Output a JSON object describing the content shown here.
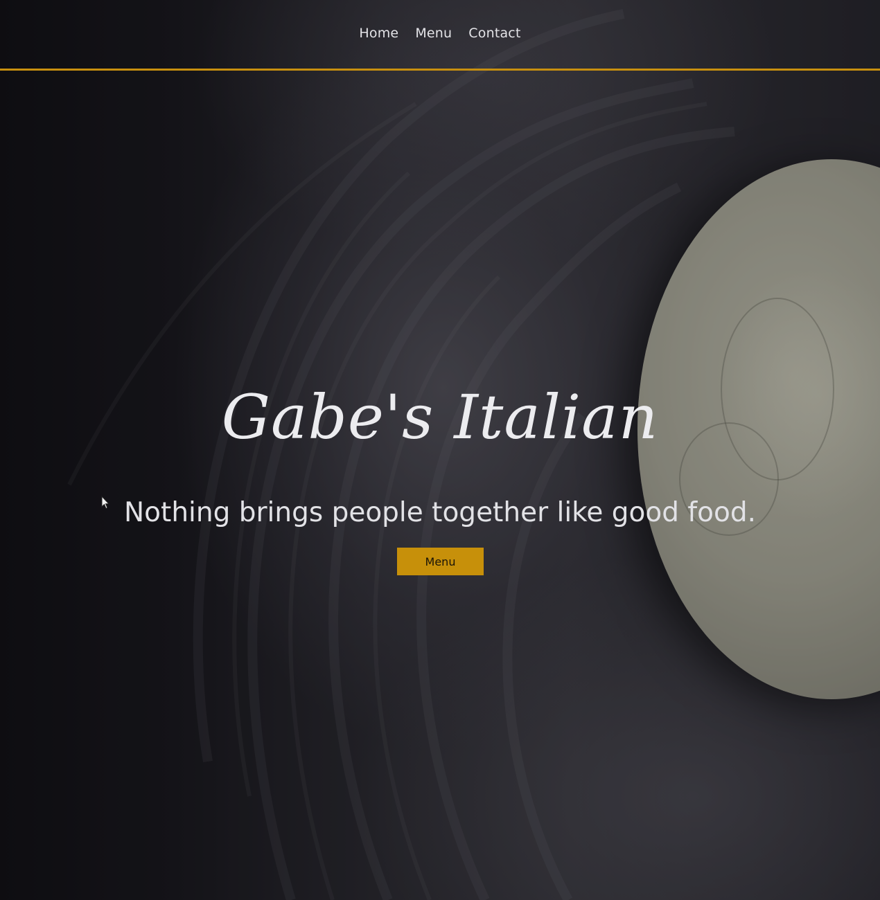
{
  "nav": {
    "items": [
      {
        "label": "Home"
      },
      {
        "label": "Menu"
      },
      {
        "label": "Contact"
      }
    ],
    "accent_color": "#c8900f"
  },
  "hero": {
    "title": "Gabe's Italian",
    "tagline": "Nothing brings people together like good food.",
    "button_label": "Menu",
    "button_color": "#c7900a",
    "background_image": "dark flour-dusted surface with pizza dough",
    "cursor_icon": "arrow-pointer-icon"
  }
}
